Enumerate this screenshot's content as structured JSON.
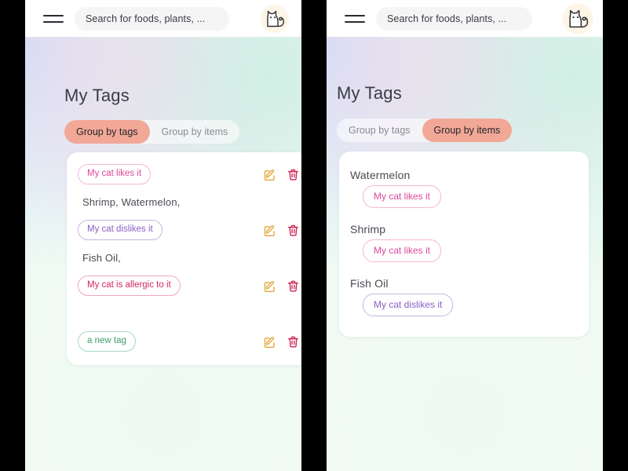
{
  "header": {
    "menu_icon": "hamburger-menu-icon",
    "search_placeholder": "Search for foods, plants, ...",
    "logo_icon": "cat-logo-icon"
  },
  "page": {
    "title": "My Tags"
  },
  "segmented": {
    "options": [
      {
        "label": "Group by tags"
      },
      {
        "label": "Group by items"
      }
    ],
    "left_panel_active": "Group by tags",
    "right_panel_active": "Group by items",
    "active_color": "#f2a897"
  },
  "icons": {
    "edit": "edit-pencil-icon",
    "delete": "trash-delete-icon",
    "edit_color": "#e3a63a",
    "delete_color": "#cf2255"
  },
  "group_by_tags": {
    "rows": [
      {
        "tag": "My cat likes it",
        "tag_color": "#e0479b",
        "tag_style": "pink",
        "items": "Shrimp,  Watermelon,"
      },
      {
        "tag": "My cat dislikes it",
        "tag_color": "#8c5fc4",
        "tag_style": "purple",
        "items": "Fish Oil,"
      },
      {
        "tag": "My cat is allergic to it",
        "tag_color": "#d2285c",
        "tag_style": "crimson",
        "items": ""
      },
      {
        "tag": "a new tag",
        "tag_color": "#3f9f6b",
        "tag_style": "green",
        "items": ""
      }
    ]
  },
  "group_by_items": {
    "blocks": [
      {
        "item": "Watermelon",
        "tags": [
          {
            "label": "My cat likes it",
            "style": "pink"
          }
        ]
      },
      {
        "item": "Shrimp",
        "tags": [
          {
            "label": "My cat likes it",
            "style": "pink"
          }
        ]
      },
      {
        "item": "Fish Oil",
        "tags": [
          {
            "label": "My cat dislikes it",
            "style": "purple"
          }
        ]
      }
    ]
  }
}
